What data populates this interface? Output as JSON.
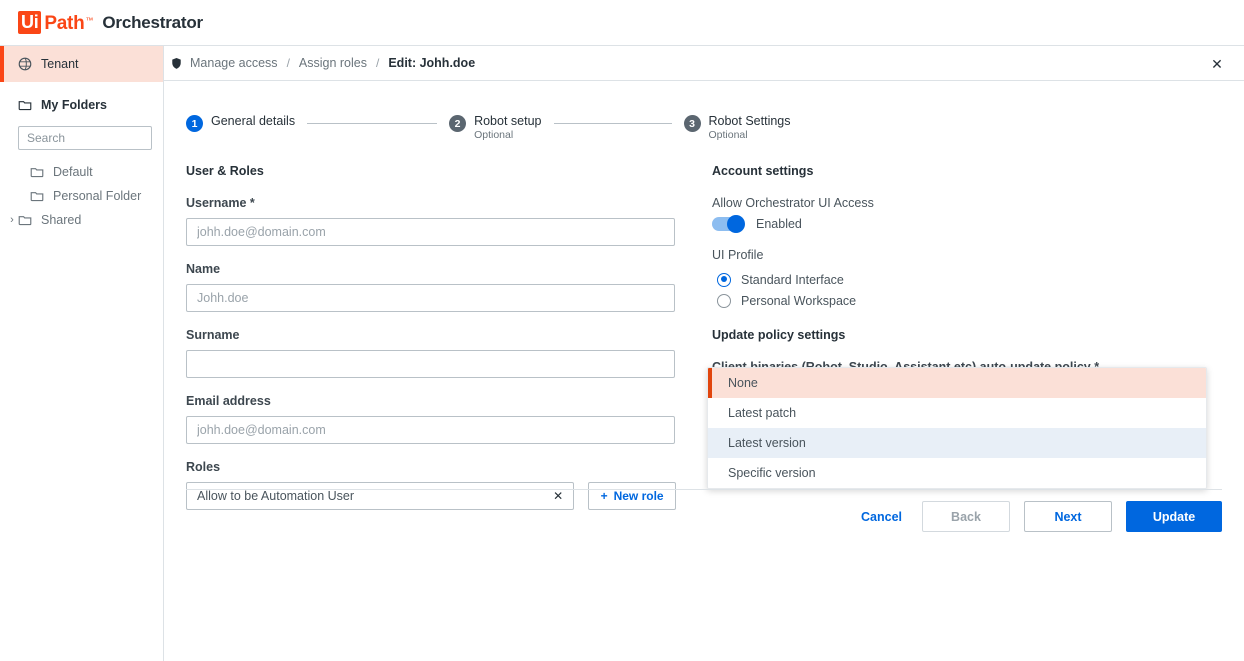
{
  "brand": {
    "logo_ui": "Ui",
    "logo_path": "Path",
    "logo_tm": "™",
    "app_title": "Orchestrator",
    "logo_color": "#fa4616"
  },
  "sidebar": {
    "tenant": {
      "label": "Tenant",
      "icon": "globe-icon",
      "accent": "#fa4616",
      "background": "#fbe0d7"
    },
    "my_folders": {
      "label": "My Folders",
      "icon": "folder-icon"
    },
    "search": {
      "placeholder": "Search",
      "value": "",
      "icon": "search-icon"
    },
    "folders": [
      {
        "label": "Default",
        "icon": "folder-icon",
        "expandable": false
      },
      {
        "label": "Personal Folder",
        "icon": "folder-icon",
        "expandable": false
      },
      {
        "label": "Shared",
        "icon": "folder-icon",
        "expandable": true,
        "chevron": "›"
      }
    ]
  },
  "breadcrumb": {
    "icon": "shield-icon",
    "items": [
      {
        "label": "Manage access",
        "current": false
      },
      {
        "label": "Assign roles",
        "current": false
      },
      {
        "label": "Edit: Johh.doe",
        "current": true
      }
    ],
    "separator": "/",
    "close_label": "✕"
  },
  "stepper": {
    "steps": [
      {
        "number": "1",
        "label": "General details",
        "sub": "",
        "active": true
      },
      {
        "number": "2",
        "label": "Robot setup",
        "sub": "Optional",
        "active": false
      },
      {
        "number": "3",
        "label": "Robot Settings",
        "sub": "Optional",
        "active": false
      }
    ],
    "active_color": "#0067df",
    "inactive_color": "#5b6670"
  },
  "form": {
    "section_title": "User & Roles",
    "username": {
      "label": "Username *",
      "placeholder": "johh.doe@domain.com",
      "value": ""
    },
    "name": {
      "label": "Name",
      "placeholder": "Johh.doe",
      "value": ""
    },
    "surname": {
      "label": "Surname",
      "placeholder": "",
      "value": ""
    },
    "email": {
      "label": "Email address",
      "placeholder": "johh.doe@domain.com",
      "value": ""
    },
    "roles": {
      "label": "Roles",
      "value": "Allow to be Automation User",
      "clear_icon": "✕",
      "new_role_button": "New role",
      "new_role_plus": "+"
    }
  },
  "account": {
    "section_title": "Account settings",
    "ui_access_label": "Allow Orchestrator UI Access",
    "toggle_state": "Enabled",
    "toggle_on": true,
    "ui_profile_label": "UI Profile",
    "ui_profile_options": [
      {
        "label": "Standard Interface",
        "selected": true
      },
      {
        "label": "Personal Workspace",
        "selected": false
      }
    ],
    "update_policy_title": "Update policy settings",
    "auto_update_label": "Client binaries (Robot, Studio, Assistant etc) auto-update policy *",
    "dropdown_options": [
      {
        "label": "None",
        "selected": true,
        "hovered": false
      },
      {
        "label": "Latest patch",
        "selected": false,
        "hovered": false
      },
      {
        "label": "Latest version",
        "selected": false,
        "hovered": true
      },
      {
        "label": "Specific version",
        "selected": false,
        "hovered": false
      }
    ],
    "selected_color": "#fbe0d7",
    "selected_bar_color": "#e1450d",
    "hover_color": "#e8eff7"
  },
  "footer": {
    "cancel": "Cancel",
    "back": "Back",
    "next": "Next",
    "update": "Update",
    "primary_color": "#0067df"
  }
}
